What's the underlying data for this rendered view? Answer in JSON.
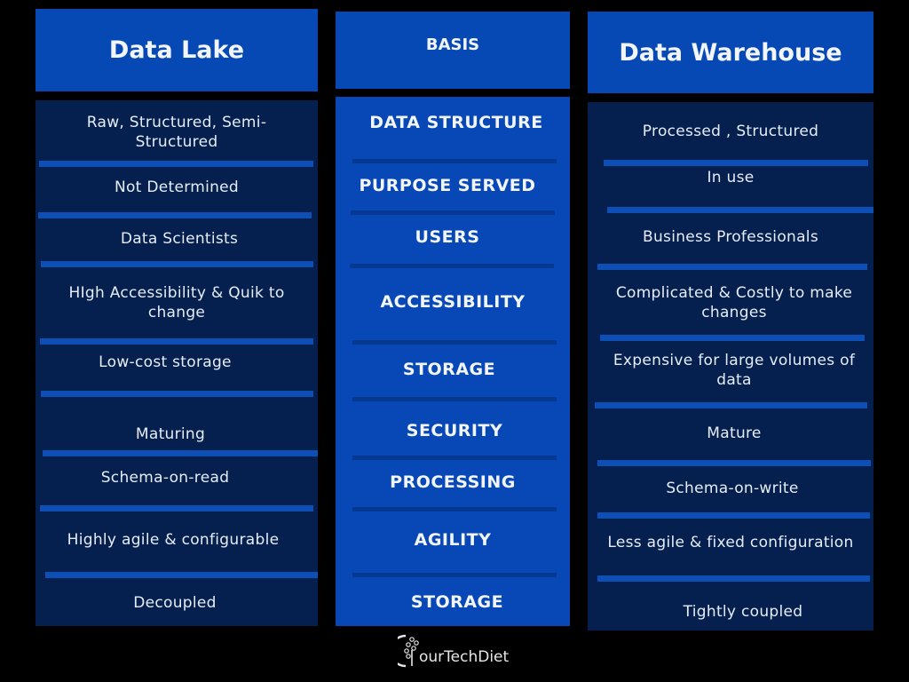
{
  "headers": {
    "data_lake": "Data Lake",
    "basis": "BASIS",
    "data_warehouse": "Data Warehouse"
  },
  "rows": [
    {
      "basis": "DATA STRUCTURE",
      "data_lake": "Raw, Structured, Semi-Structured",
      "data_warehouse": "Processed , Structured"
    },
    {
      "basis": "PURPOSE SERVED",
      "data_lake": "Not Determined",
      "data_warehouse": "In use"
    },
    {
      "basis": "USERS",
      "data_lake": "Data Scientists",
      "data_warehouse": "Business Professionals"
    },
    {
      "basis": "ACCESSIBILITY",
      "data_lake": "HIgh Accessibility & Quik to change",
      "data_warehouse": "Complicated & Costly to make changes"
    },
    {
      "basis": "STORAGE",
      "data_lake": "Low-cost storage",
      "data_warehouse": "Expensive for large volumes of data"
    },
    {
      "basis": "SECURITY",
      "data_lake": "Maturing",
      "data_warehouse": "Mature"
    },
    {
      "basis": "PROCESSING",
      "data_lake": "Schema-on-read",
      "data_warehouse": "Schema-on-write"
    },
    {
      "basis": "AGILITY",
      "data_lake": "Highly agile & configurable",
      "data_warehouse": "Less agile & fixed configuration"
    },
    {
      "basis": "STORAGE",
      "data_lake": "Decoupled",
      "data_warehouse": "Tightly coupled"
    }
  ],
  "footer": {
    "logo_icon": "tree-circuit-logo-icon",
    "brand": "ourTechDiet"
  },
  "colors": {
    "background": "#000000",
    "header_blue": "#0648b4",
    "side_column": "#05204f",
    "divider_blue": "#0d4fb5",
    "basis_divider": "#053890",
    "text": "#e6edf7"
  }
}
